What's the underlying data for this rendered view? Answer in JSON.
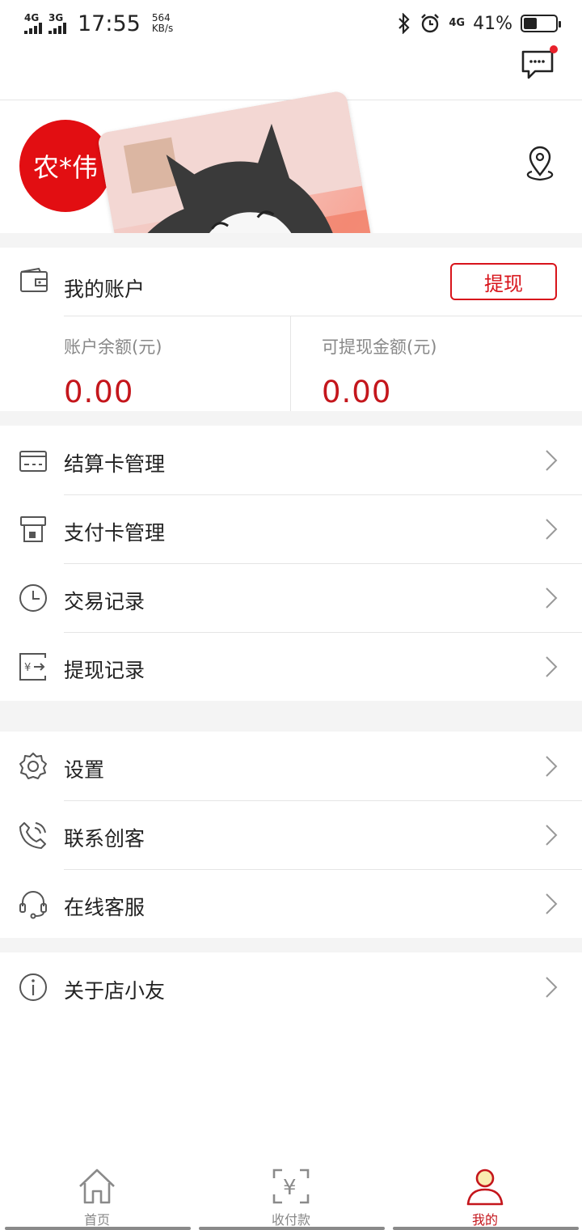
{
  "status_bar": {
    "net1": "4G",
    "net2": "3G",
    "time": "17:55",
    "speed_value": "564",
    "speed_unit": "KB/s",
    "net3": "4G",
    "battery": "41%",
    "battery_level": 0.41
  },
  "user": {
    "name": "农*伟"
  },
  "account": {
    "title": "我的账户",
    "withdraw_label": "提现",
    "balance_label": "账户余额(元)",
    "balance_value": "0.00",
    "withdrawable_label": "可提现金额(元)",
    "withdrawable_value": "0.00"
  },
  "menu_cards": [
    {
      "label": "结算卡管理",
      "icon": "settlement-card-icon"
    },
    {
      "label": "支付卡管理",
      "icon": "payment-card-icon"
    },
    {
      "label": "交易记录",
      "icon": "clock-icon"
    },
    {
      "label": "提现记录",
      "icon": "withdraw-record-icon"
    }
  ],
  "menu_support": [
    {
      "label": "设置",
      "icon": "gear-icon"
    },
    {
      "label": "联系创客",
      "icon": "phone-icon"
    },
    {
      "label": "在线客服",
      "icon": "headset-icon"
    }
  ],
  "menu_about": [
    {
      "label": "关于店小友",
      "icon": "info-icon"
    }
  ],
  "bottom_nav": [
    {
      "label": "首页",
      "icon": "home-icon",
      "active": false
    },
    {
      "label": "收付款",
      "icon": "yuan-scan-icon",
      "active": false
    },
    {
      "label": "我的",
      "icon": "user-icon",
      "active": true
    }
  ],
  "colors": {
    "accent": "#c4161c",
    "avatar_bg": "#e20e12",
    "divider": "#e5e5e5",
    "gap_bg": "#f4f4f4"
  }
}
